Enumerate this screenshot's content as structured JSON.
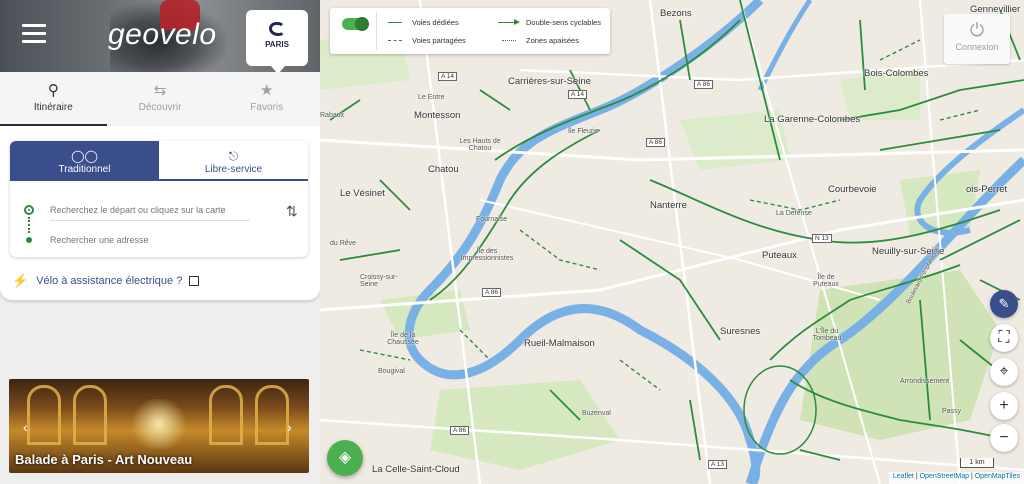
{
  "header": {
    "brand": "geovelo",
    "partner_badge": "PARIS"
  },
  "nav_tabs": [
    {
      "label": "Itinéraire",
      "icon": "map-pin-icon",
      "active": true
    },
    {
      "label": "Découvrir",
      "icon": "route-icon",
      "active": false
    },
    {
      "label": "Favoris",
      "icon": "star-icon",
      "active": false
    }
  ],
  "mode_tabs": [
    {
      "label": "Traditionnel",
      "icon": "bicycle-icon",
      "active": true
    },
    {
      "label": "Libre-service",
      "icon": "bike-share-icon",
      "active": false
    }
  ],
  "route": {
    "start_placeholder": "Recherchez le départ ou cliquez sur la carte",
    "end_placeholder": "Rechercher une adresse"
  },
  "ebike_label": "Vélo à assistance électrique ?",
  "promo": {
    "title": "Balade à Paris - Art Nouveau"
  },
  "legend": {
    "dedicated": "Voies dédiées",
    "shared": "Voies partagées",
    "two_way": "Double-sens cyclables",
    "calm": "Zones apaisées"
  },
  "login_label": "Connexion",
  "scale_label": "1 km",
  "attribution": {
    "leaflet": "Leaflet",
    "osm": "OpenStreetMap",
    "omt": "OpenMapTiles",
    "sep": " | "
  },
  "places": {
    "bezons": "Bezons",
    "gennevilliers": "Gennevillier",
    "carrieres": "Carrières-sur-Seine",
    "bois_colombes": "Bois-Colombes",
    "lentre": "Le Entre",
    "rabaux": "Rabaux",
    "montesson": "Montesson",
    "ile_fleurie": "Île Fleurie",
    "garenne": "La Garenne-Colombes",
    "hauts_chatou": "Les Hauts de Chatou",
    "chatou": "Chatou",
    "courbevoie": "Courbevoie",
    "bois_perret": "ois-Perret",
    "vesinet": "Le Vésinet",
    "nanterre": "Nanterre",
    "defense": "La Défense",
    "fournaise": "Fournaise",
    "impressionnistes": "Île des Impressionnistes",
    "puteaux": "Puteaux",
    "neuilly": "Neuilly-sur-Seine",
    "dureve": "du Rêve",
    "croissy": "Croissy-sur-Seine",
    "ile_puteaux": "Île de Puteaux",
    "ile_tombeau": "L'Île du Tombeau",
    "suresnes": "Suresnes",
    "rueil": "Rueil-Malmaison",
    "ile_chaussee": "Île de la Chaussée",
    "bougival": "Bougival",
    "arrondissement": "Arrondissement",
    "passy": "Passy",
    "buzenval": "Buzenval",
    "celle": "La Celle-Saint-Cloud",
    "peripherique": "Boulevard Périphérique"
  },
  "road_shields": {
    "a14": "A 14",
    "a14b": "A 14",
    "a86a": "A 86",
    "a86b": "A 86",
    "a86c": "A 86",
    "a86d": "A 86",
    "n13": "N 13",
    "a13": "A 13"
  },
  "colors": {
    "accent_blue": "#3a4e8c",
    "cycle_green": "#2e8b3e",
    "river": "#79b0e6",
    "park": "#cfe3b6"
  }
}
